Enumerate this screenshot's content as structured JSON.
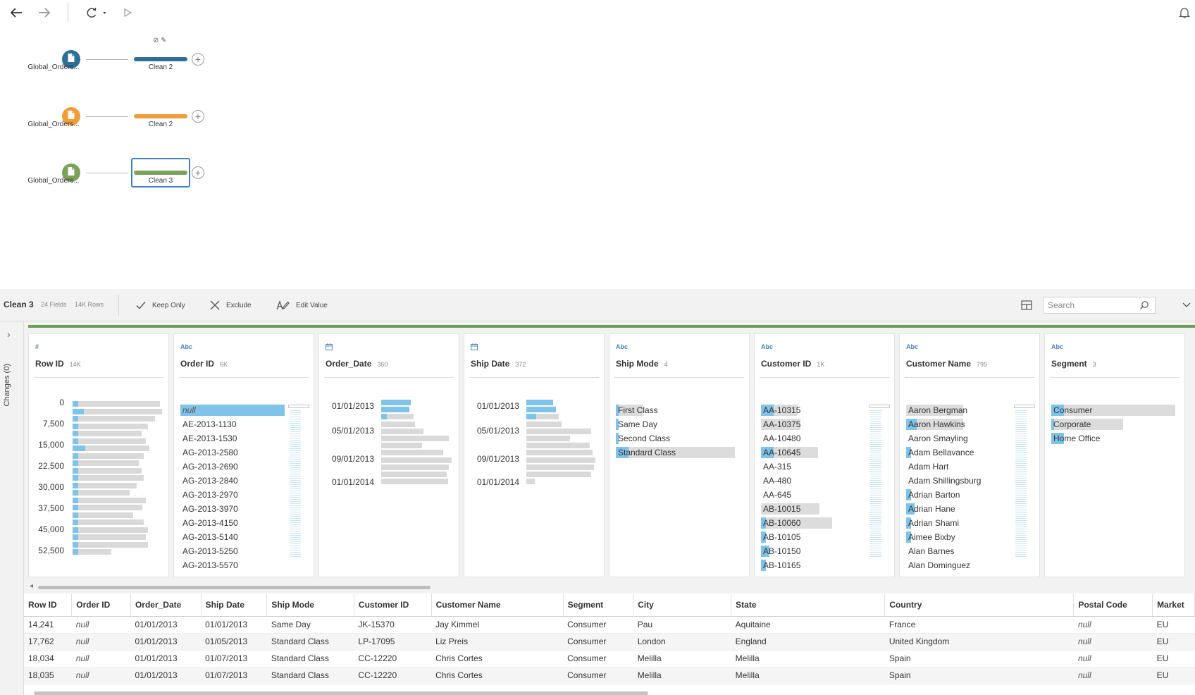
{
  "toolbar": {
    "back_icon": "arrow-left-icon",
    "forward_icon": "arrow-right-icon",
    "refresh_icon": "refresh-icon",
    "run_icon": "play-icon",
    "notify_icon": "bell-icon"
  },
  "flow": {
    "rows": [
      {
        "input_label": "Global_Orders...",
        "clean_label": "Clean 2",
        "color": "#2e6e99"
      },
      {
        "input_label": "Global_Orders...",
        "clean_label": "Clean 2",
        "color": "#f29d38"
      },
      {
        "input_label": "Global_Orders...",
        "clean_label": "Clean 3",
        "color": "#7ba259"
      }
    ]
  },
  "profile_toolbar": {
    "title": "Clean 3",
    "fields": "24 Fields",
    "rows": "14K Rows",
    "keep_only": "Keep Only",
    "exclude": "Exclude",
    "edit_value": "Edit Value",
    "search_placeholder": "Search"
  },
  "side_panel": {
    "changes_label": "Changes (0)"
  },
  "cards": [
    {
      "type": "#",
      "title": "Row ID",
      "count": "14K",
      "kind": "hist",
      "labels": [
        "0",
        "7,500",
        "15,000",
        "22,500",
        "30,000",
        "37,500",
        "45,000",
        "52,500"
      ],
      "bars": [
        0.95,
        0.98,
        0.9,
        0.82,
        0.75,
        0.8,
        0.84,
        0.78,
        0.72,
        0.75,
        0.78,
        0.7,
        0.62,
        0.8,
        0.76,
        0.66,
        0.78,
        0.82,
        0.8,
        0.82,
        0.42
      ],
      "highlights": [
        0.06,
        0.12,
        0.06,
        0.06,
        0.06,
        0.06,
        0.14,
        0.06,
        0.06,
        0.06,
        0.06,
        0.06,
        0.06,
        0.06,
        0.06,
        0.06,
        0.06,
        0.06,
        0.06,
        0.06,
        0.06
      ]
    },
    {
      "type": "Abc",
      "title": "Order ID",
      "count": "6K",
      "kind": "cat",
      "items": [
        {
          "label": "null",
          "bar": 1.0,
          "hl": 1.0,
          "null": true
        },
        {
          "label": "AE-2013-1130",
          "bar": 0,
          "hl": 0
        },
        {
          "label": "AE-2013-1530",
          "bar": 0,
          "hl": 0
        },
        {
          "label": "AG-2013-2580",
          "bar": 0,
          "hl": 0
        },
        {
          "label": "AG-2013-2690",
          "bar": 0,
          "hl": 0
        },
        {
          "label": "AG-2013-2840",
          "bar": 0,
          "hl": 0
        },
        {
          "label": "AG-2013-2970",
          "bar": 0,
          "hl": 0
        },
        {
          "label": "AG-2013-3970",
          "bar": 0,
          "hl": 0
        },
        {
          "label": "AG-2013-4150",
          "bar": 0,
          "hl": 0
        },
        {
          "label": "AG-2013-5140",
          "bar": 0,
          "hl": 0
        },
        {
          "label": "AG-2013-5250",
          "bar": 0,
          "hl": 0
        },
        {
          "label": "AG-2013-5570",
          "bar": 0,
          "hl": 0
        }
      ]
    },
    {
      "type": "date",
      "title": "Order_Date",
      "count": "360",
      "kind": "date",
      "labels": [
        "01/01/2013",
        "05/01/2013",
        "09/01/2013",
        "01/01/2014"
      ],
      "bars": [
        0.42,
        0.4,
        0.46,
        0.48,
        0.6,
        0.96,
        0.58,
        0.88,
        1.0,
        0.96,
        0.93,
        0.95
      ],
      "highlights": [
        0.42,
        0.4,
        0.08,
        0,
        0,
        0,
        0,
        0,
        0,
        0,
        0,
        0
      ]
    },
    {
      "type": "date",
      "title": "Ship Date",
      "count": "372",
      "kind": "date",
      "labels": [
        "01/01/2013",
        "05/01/2013",
        "09/01/2013",
        "01/01/2014"
      ],
      "bars": [
        0.38,
        0.42,
        0.46,
        0.5,
        0.92,
        0.62,
        0.9,
        0.94,
        0.98,
        0.96,
        0.92,
        0.12
      ],
      "highlights": [
        0.38,
        0.42,
        0.14,
        0,
        0,
        0,
        0,
        0,
        0,
        0,
        0,
        0
      ]
    },
    {
      "type": "Abc",
      "title": "Ship Mode",
      "count": "4",
      "kind": "cat",
      "items": [
        {
          "label": "First Class",
          "bar": 0.22,
          "hl": 0.02
        },
        {
          "label": "Same Day",
          "bar": 0.0,
          "hl": 0.02
        },
        {
          "label": "Second Class",
          "bar": 0.0,
          "hl": 0.02
        },
        {
          "label": "Standard Class",
          "bar": 0.96,
          "hl": 0.1
        }
      ]
    },
    {
      "type": "Abc",
      "title": "Customer ID",
      "count": "1K",
      "kind": "cat",
      "items": [
        {
          "label": "AA-10315",
          "bar": 0.35,
          "hl": 0.12
        },
        {
          "label": "AA-10375",
          "bar": 0.38,
          "hl": 0.0
        },
        {
          "label": "AA-10480",
          "bar": 0.0,
          "hl": 0.0
        },
        {
          "label": "AA-10645",
          "bar": 0.55,
          "hl": 0.12
        },
        {
          "label": "AA-315",
          "bar": 0.0,
          "hl": 0.0
        },
        {
          "label": "AA-480",
          "bar": 0.0,
          "hl": 0.0
        },
        {
          "label": "AA-645",
          "bar": 0.0,
          "hl": 0.0
        },
        {
          "label": "AB-10015",
          "bar": 0.56,
          "hl": 0.0
        },
        {
          "label": "AB-10060",
          "bar": 0.68,
          "hl": 0.05
        },
        {
          "label": "AB-10105",
          "bar": 0.0,
          "hl": 0.05
        },
        {
          "label": "AB-10150",
          "bar": 0.0,
          "hl": 0.08
        },
        {
          "label": "AB-10165",
          "bar": 0.0,
          "hl": 0.05
        }
      ]
    },
    {
      "type": "Abc",
      "title": "Customer Name",
      "count": "795",
      "kind": "cat",
      "items": [
        {
          "label": "Aaron Bergman",
          "bar": 0.55,
          "hl": 0.0
        },
        {
          "label": "Aaron Hawkins",
          "bar": 0.55,
          "hl": 0.1
        },
        {
          "label": "Aaron Smayling",
          "bar": 0.0,
          "hl": 0.0
        },
        {
          "label": "Adam Bellavance",
          "bar": 0.0,
          "hl": 0.05
        },
        {
          "label": "Adam Hart",
          "bar": 0.0,
          "hl": 0.0
        },
        {
          "label": "Adam Shillingsburg",
          "bar": 0.0,
          "hl": 0.0
        },
        {
          "label": "Adrian Barton",
          "bar": 0.0,
          "hl": 0.05
        },
        {
          "label": "Adrian Hane",
          "bar": 0.0,
          "hl": 0.08
        },
        {
          "label": "Adrian Shami",
          "bar": 0.0,
          "hl": 0.05
        },
        {
          "label": "Aimee Bixby",
          "bar": 0.0,
          "hl": 0.05
        },
        {
          "label": "Alan Barnes",
          "bar": 0.0,
          "hl": 0.0
        },
        {
          "label": "Alan Dominguez",
          "bar": 0.0,
          "hl": 0.0
        }
      ]
    },
    {
      "type": "Abc",
      "title": "Segment",
      "count": "3",
      "kind": "cat",
      "items": [
        {
          "label": "Consumer",
          "bar": 1.0,
          "hl": 0.1
        },
        {
          "label": "Corporate",
          "bar": 0.58,
          "hl": 0.02
        },
        {
          "label": "Home Office",
          "bar": 0.0,
          "hl": 0.1
        }
      ]
    }
  ],
  "grid": {
    "columns": [
      "Row ID",
      "Order ID",
      "Order_Date",
      "Ship Date",
      "Ship Mode",
      "Customer ID",
      "Customer Name",
      "Segment",
      "City",
      "State",
      "Country",
      "Postal Code",
      "Market"
    ],
    "rows": [
      [
        "14,241",
        "null",
        "01/01/2013",
        "01/01/2013",
        "Same Day",
        "JK-15370",
        "Jay Kimmel",
        "Consumer",
        "Pau",
        "Aquitaine",
        "France",
        "null",
        "EU"
      ],
      [
        "17,762",
        "null",
        "01/01/2013",
        "01/05/2013",
        "Standard Class",
        "LP-17095",
        "Liz Preis",
        "Consumer",
        "London",
        "England",
        "United Kingdom",
        "null",
        "EU"
      ],
      [
        "18,034",
        "null",
        "01/01/2013",
        "01/07/2013",
        "Standard Class",
        "CC-12220",
        "Chris Cortes",
        "Consumer",
        "Melilla",
        "Melilla",
        "Spain",
        "null",
        "EU"
      ],
      [
        "18,035",
        "null",
        "01/01/2013",
        "01/07/2013",
        "Standard Class",
        "CC-12220",
        "Chris Cortes",
        "Consumer",
        "Melilla",
        "Melilla",
        "Spain",
        "null",
        "EU"
      ]
    ]
  }
}
